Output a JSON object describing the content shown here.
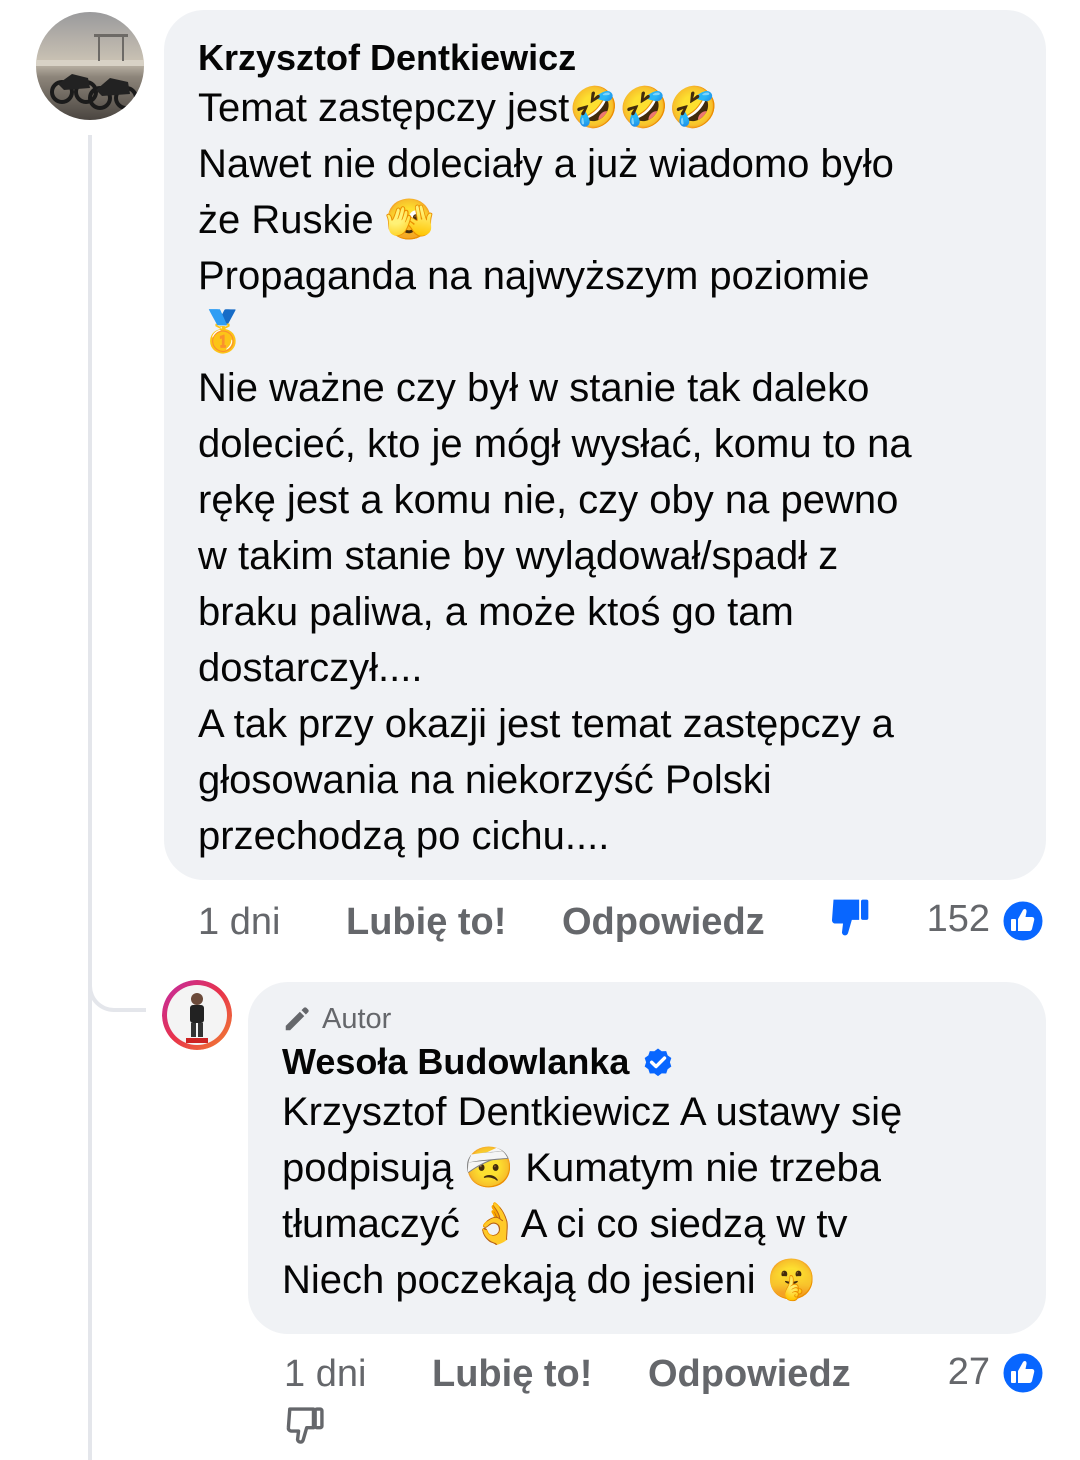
{
  "thread": [
    {
      "author": "Krzysztof Dentkiewicz",
      "avatar_icon": "motorcycles-photo-avatar",
      "lines": [
        "Temat zastępczy jest🤣🤣🤣",
        "Nawet nie doleciały a już wiadomo było",
        "że Ruskie 🫣",
        "Propaganda na najwyższym poziomie",
        "🥇",
        "Nie ważne czy był w stanie tak daleko",
        "dolecieć, kto je mógł wysłać, komu to na",
        "rękę jest a komu nie, czy oby na pewno",
        "w takim stanie by wylądował/spadł z",
        "braku paliwa, a może ktoś go tam",
        "dostarczył....",
        "A tak przy okazji jest temat zastępczy a",
        "głosowania na niekorzyść Polski",
        "przechodzą po cichu...."
      ],
      "time": "1 dni",
      "like_label": "Lubię to!",
      "reply_label": "Odpowiedz",
      "reaction_count": "152",
      "dislike_state": "active"
    },
    {
      "badge": "Autor",
      "author": "Wesoła Budowlanka",
      "verified": true,
      "avatar_icon": "person-photo-avatar",
      "lines": [
        "Krzysztof Dentkiewicz A ustawy się",
        "podpisują 🤕 Kumatym nie trzeba",
        "tłumaczyć 👌A ci co siedzą w tv",
        "Niech poczekają do jesieni 🤫"
      ],
      "time": "1 dni",
      "like_label": "Lubię to!",
      "reply_label": "Odpowiedz",
      "reaction_count": "27",
      "dislike_state": "inactive"
    }
  ],
  "colors": {
    "bubble_bg": "#f0f2f5",
    "text_primary": "#050505",
    "text_secondary": "#65676b",
    "brand_blue": "#0866ff",
    "thread_line": "#e4e6eb"
  }
}
